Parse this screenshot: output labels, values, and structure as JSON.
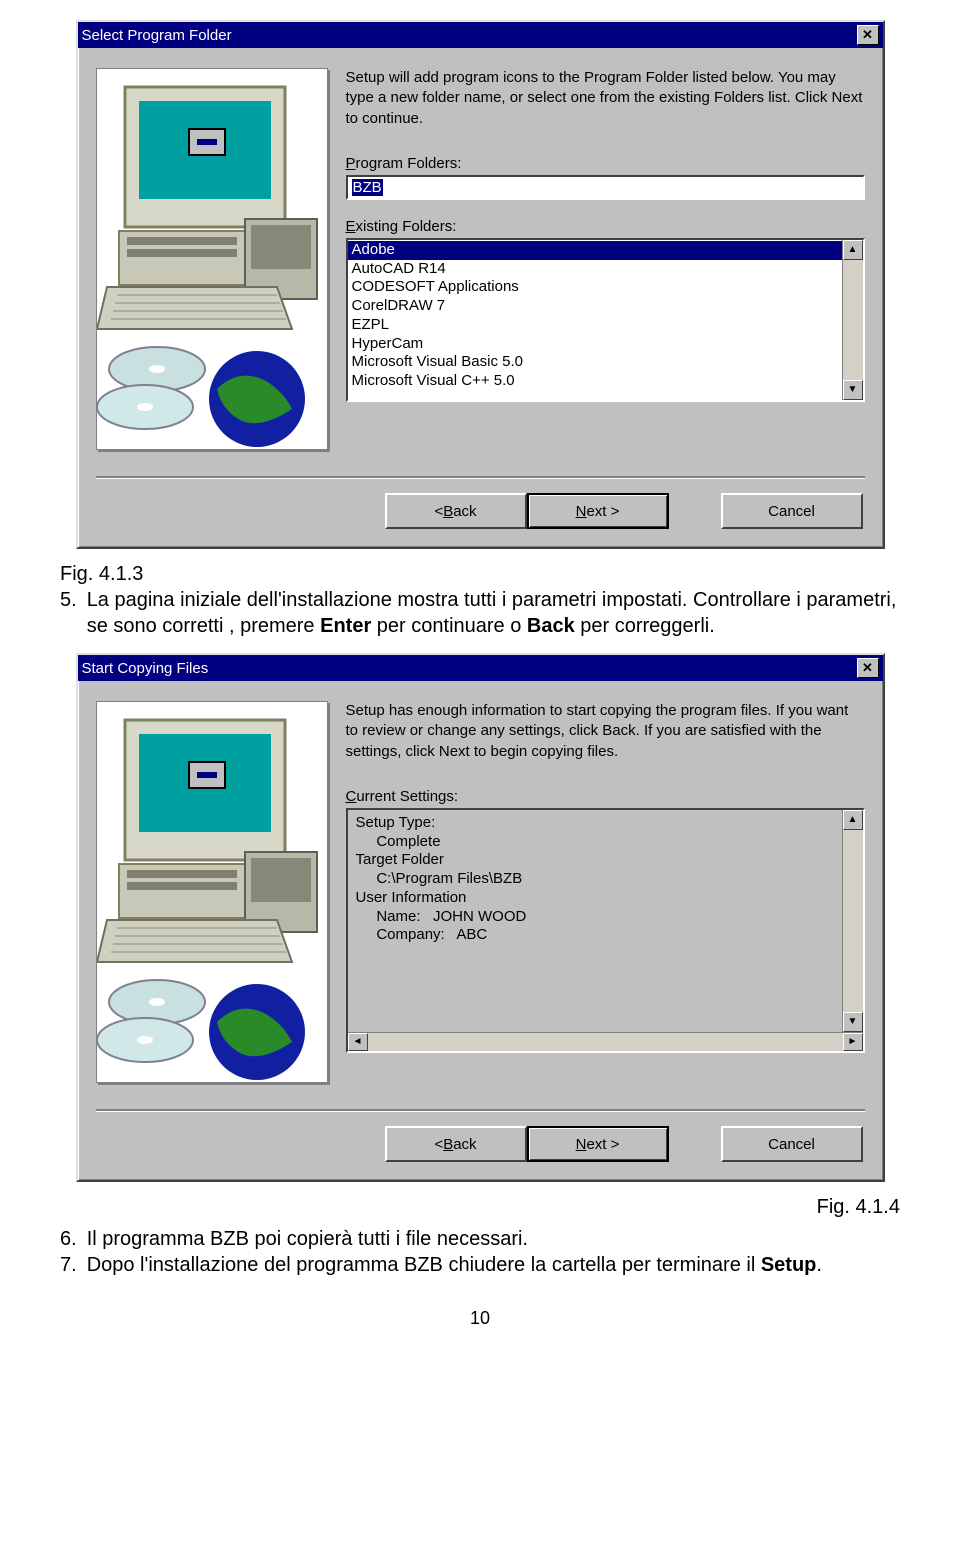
{
  "dialog1": {
    "title": "Select Program Folder",
    "instructions": "Setup will add program icons to the Program Folder listed below. You may type a new folder name, or select one from the existing Folders list.  Click Next to continue.",
    "program_folders_label_pre": "P",
    "program_folders_label_post": "rogram Folders:",
    "program_folder_value": "BZB",
    "existing_label_pre": "E",
    "existing_label_post": "xisting Folders:",
    "existing_items": [
      "Adobe",
      "AutoCAD R14",
      "CODESOFT Applications",
      "CorelDRAW 7",
      "EZPL",
      "HyperCam",
      "Microsoft Visual Basic 5.0",
      "Microsoft Visual C++ 5.0"
    ],
    "buttons": {
      "back_pre": "< ",
      "back_ul": "B",
      "back_post": "ack",
      "next_ul": "N",
      "next_post": "ext >",
      "cancel": "Cancel"
    }
  },
  "para1": {
    "fig": "Fig. 4.1.3",
    "item_no": "5.",
    "text_a": "La pagina iniziale dell'installazione mostra tutti i parametri impostati. Controllare i parametri, se sono corretti , premere ",
    "bold1": "Enter",
    "text_b": " per continuare o ",
    "bold2": "Back",
    "text_c": " per correggerli."
  },
  "dialog2": {
    "title": "Start Copying Files",
    "instructions": "Setup has enough information to start copying the program files. If you want to review or change any settings, click Back.  If you are satisfied with the settings, click Next to begin copying files.",
    "current_label_pre": "C",
    "current_label_post": "urrent Settings:",
    "lines": [
      "Setup Type:",
      "     Complete",
      "",
      "Target Folder",
      "     C:\\Program Files\\BZB",
      "",
      "User Information",
      "     Name:   JOHN WOOD",
      "     Company:   ABC"
    ],
    "buttons": {
      "back_pre": "< ",
      "back_ul": "B",
      "back_post": "ack",
      "next_ul": "N",
      "next_post": "ext >",
      "cancel": "Cancel"
    }
  },
  "para2": {
    "fig": "Fig. 4.1.4",
    "item6_no": "6.",
    "item6_text": "Il programma BZB poi copierà tutti i file necessari.",
    "item7_no": "7.",
    "item7_text_a": "Dopo l'installazione del programma BZB chiudere la cartella per terminare il ",
    "item7_bold": "Setup",
    "item7_text_b": "."
  },
  "page_number": "10"
}
